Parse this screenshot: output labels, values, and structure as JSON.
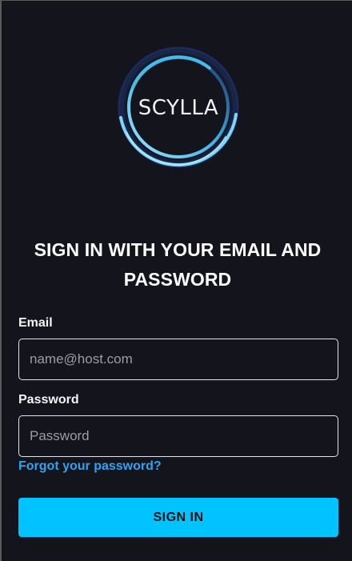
{
  "logo": {
    "text": "SCYLLA",
    "ring_color": "#4fc3ee",
    "ring_inner_color": "#1f2f5a"
  },
  "heading": {
    "line1": "SIGN IN WITH YOUR EMAIL AND",
    "line2": "PASSWORD"
  },
  "form": {
    "email_label": "Email",
    "email_placeholder": "name@host.com",
    "email_value": "",
    "password_label": "Password",
    "password_placeholder": "Password",
    "password_value": "",
    "forgot_link": "Forgot your password?",
    "submit_label": "SIGN IN"
  },
  "colors": {
    "background": "#13141c",
    "accent": "#00c3ff",
    "link": "#2ea3f2"
  }
}
